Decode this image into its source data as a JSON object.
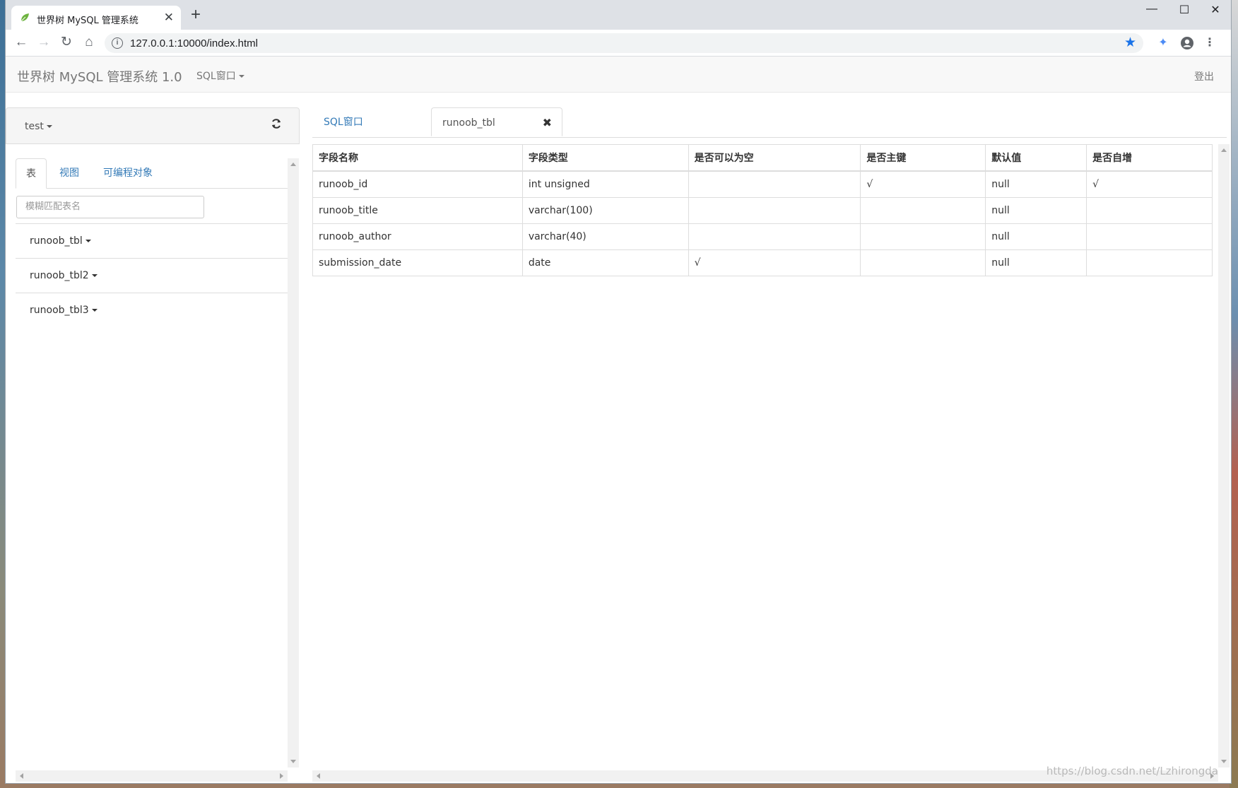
{
  "browser": {
    "tab_title": "世界树 MySQL 管理系统",
    "url": "127.0.0.1:10000/index.html",
    "new_tab": "+",
    "tab_close": "✕"
  },
  "navbar": {
    "brand": "世界树 MySQL 管理系统 1.0",
    "sql_menu": "SQL窗口",
    "logout": "登出"
  },
  "sidebar": {
    "database": "test",
    "tabs": [
      "表",
      "视图",
      "可编程对象"
    ],
    "search_placeholder": "模糊匹配表名",
    "tables": [
      "runoob_tbl",
      "runoob_tbl2",
      "runoob_tbl3"
    ]
  },
  "main": {
    "tabs": [
      "SQL窗口",
      "runoob_tbl"
    ],
    "columns": [
      "字段名称",
      "字段类型",
      "是否可以为空",
      "是否主键",
      "默认值",
      "是否自增"
    ],
    "rows": [
      [
        "runoob_id",
        "int unsigned",
        "",
        "√",
        "null",
        "√"
      ],
      [
        "runoob_title",
        "varchar(100)",
        "",
        "",
        "null",
        ""
      ],
      [
        "runoob_author",
        "varchar(40)",
        "",
        "",
        "null",
        ""
      ],
      [
        "submission_date",
        "date",
        "√",
        "",
        "null",
        ""
      ]
    ]
  },
  "watermark": "https://blog.csdn.net/Lzhirongda"
}
